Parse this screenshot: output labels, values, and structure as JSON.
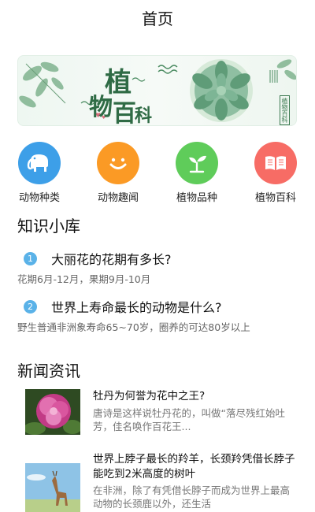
{
  "header": {
    "title": "首页"
  },
  "banner": {
    "title_chars": [
      "植",
      "物",
      "百",
      "科"
    ],
    "stamp_text": "植物百科"
  },
  "categories": [
    {
      "label": "动物种类",
      "icon": "elephant-icon",
      "color": "#3d9fe8"
    },
    {
      "label": "动物趣闻",
      "icon": "smile-icon",
      "color": "#fb9a25"
    },
    {
      "label": "植物品种",
      "icon": "sprout-icon",
      "color": "#5fcc5a"
    },
    {
      "label": "植物百科",
      "icon": "book-icon",
      "color": "#f76c65"
    }
  ],
  "knowledge": {
    "title": "知识小库",
    "items": [
      {
        "num": "1",
        "question": "大丽花的花期有多长?",
        "answer": "花期6月-12月，果期9月-10月"
      },
      {
        "num": "2",
        "question": "世界上寿命最长的动物是什么?",
        "answer": "野生普通非洲象寿命65~70岁，圈养的可达80岁以上"
      }
    ]
  },
  "news": {
    "title": "新闻资讯",
    "items": [
      {
        "title": "牡丹为何誉为花中之王?",
        "desc": "唐诗是这样说牡丹花的，叫做“落尽残红始吐芳，佳名唤作百花王..."
      },
      {
        "title": "世界上脖子最长的羚羊，长颈羚凭借长脖子能吃到2米高度的树叶",
        "desc": "在非洲，除了有凭借长脖子而成为世界上最高动物的长颈鹿以外，还生活"
      }
    ]
  }
}
